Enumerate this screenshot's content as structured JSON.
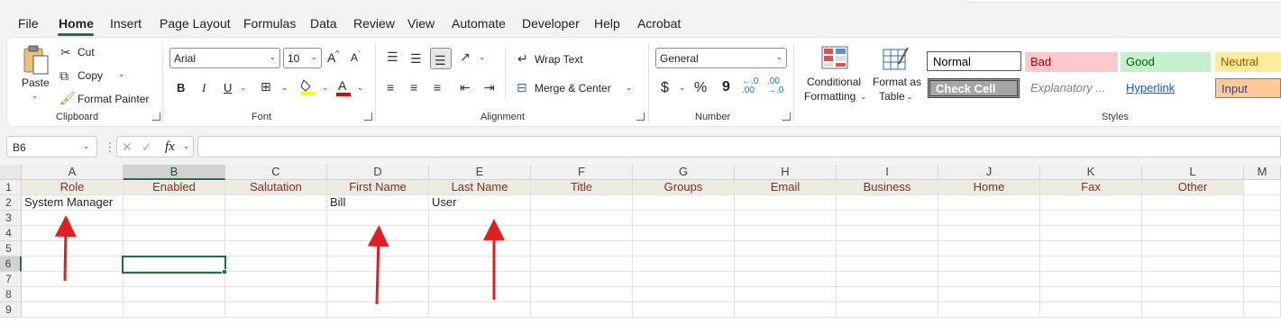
{
  "menu": [
    "File",
    "Home",
    "Insert",
    "Page Layout",
    "Formulas",
    "Data",
    "Review",
    "View",
    "Automate",
    "Developer",
    "Help",
    "Acrobat"
  ],
  "clipboard": {
    "paste": "Paste",
    "cut": "Cut",
    "copy": "Copy",
    "format_painter": "Format Painter",
    "label": "Clipboard"
  },
  "font": {
    "name": "Arial",
    "size": "10",
    "label": "Font",
    "bold": "B",
    "italic": "I",
    "underline": "U",
    "grow": "A",
    "shrink": "A",
    "font_color_letter": "A"
  },
  "alignment": {
    "wrap_text": "Wrap Text",
    "merge_center": "Merge & Center",
    "label": "Alignment"
  },
  "number": {
    "format": "General",
    "currency": "$",
    "percent": "%",
    "comma": "9",
    "label": "Number"
  },
  "styles": {
    "conditional_formatting": [
      "Conditional",
      "Formatting"
    ],
    "format_as_table": [
      "Format as",
      "Table"
    ],
    "gallery": [
      {
        "label": "Normal",
        "bg": "#ffffff",
        "fg": "#000000"
      },
      {
        "label": "Bad",
        "bg": "#ffc7ce",
        "fg": "#9c0006"
      },
      {
        "label": "Good",
        "bg": "#c6efce",
        "fg": "#006100"
      },
      {
        "label": "Neutral",
        "bg": "#ffeb9c",
        "fg": "#9c5700"
      },
      {
        "label": "Check Cell",
        "bg": "#a5a5a5",
        "fg": "#ffffff"
      },
      {
        "label": "Explanatory ...",
        "bg": "#ffffff",
        "fg": "#7f7f7f"
      },
      {
        "label": "Hyperlink",
        "bg": "#ffffff",
        "fg": "#0563c1"
      },
      {
        "label": "Input",
        "bg": "#ffcc99",
        "fg": "#3f3f76"
      }
    ],
    "label": "Styles"
  },
  "formula_bar": {
    "name_box": "B6",
    "fx": "fx",
    "value": ""
  },
  "columns": [
    "A",
    "B",
    "C",
    "D",
    "E",
    "F",
    "G",
    "H",
    "I",
    "J",
    "K",
    "L",
    "M"
  ],
  "rows": [
    "1",
    "2",
    "3",
    "4",
    "5",
    "6",
    "7",
    "8",
    "9"
  ],
  "header_row": [
    "Role",
    "Enabled",
    "Salutation",
    "First Name",
    "Last Name",
    "Title",
    "Groups",
    "Email",
    "Business",
    "Home",
    "Fax",
    "Other"
  ],
  "data_row": [
    "System Manager",
    "",
    "",
    "Bill",
    "User",
    "",
    "",
    "",
    "",
    "",
    "",
    ""
  ],
  "selected_cell": "B6",
  "accent_color": "#1e7145",
  "annotation_color": "#e02020"
}
